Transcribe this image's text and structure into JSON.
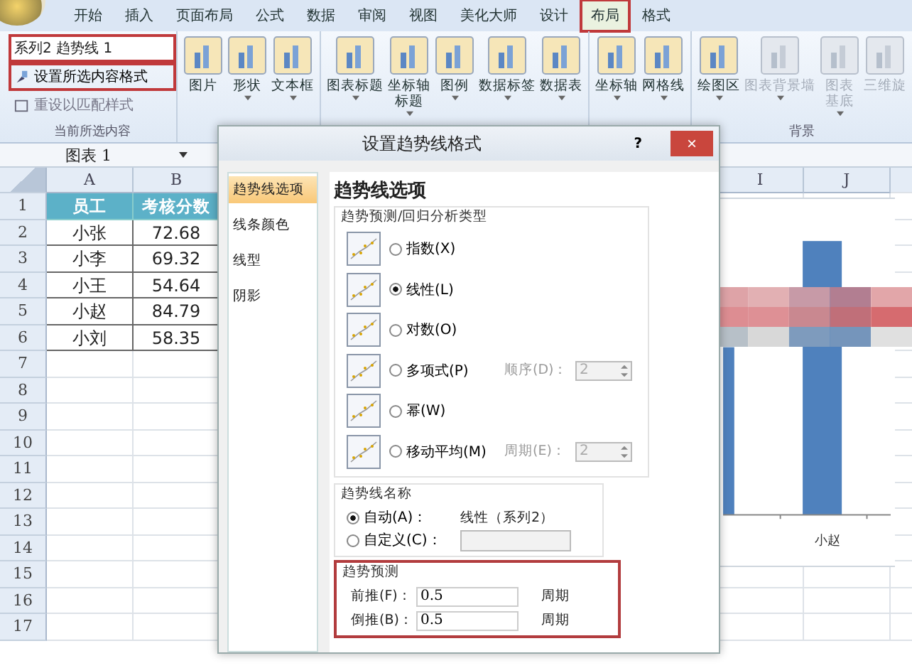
{
  "ribbon_tabs": [
    {
      "label": "开始",
      "selected": false,
      "highlighted": false
    },
    {
      "label": "插入",
      "selected": false,
      "highlighted": false
    },
    {
      "label": "页面布局",
      "selected": false,
      "highlighted": false
    },
    {
      "label": "公式",
      "selected": false,
      "highlighted": false
    },
    {
      "label": "数据",
      "selected": false,
      "highlighted": false
    },
    {
      "label": "审阅",
      "selected": false,
      "highlighted": false
    },
    {
      "label": "视图",
      "selected": false,
      "highlighted": false
    },
    {
      "label": "美化大师",
      "selected": false,
      "highlighted": false
    },
    {
      "label": "设计",
      "selected": false,
      "highlighted": false
    },
    {
      "label": "布局",
      "selected": true,
      "highlighted": true
    },
    {
      "label": "格式",
      "selected": false,
      "highlighted": false
    }
  ],
  "selection_group": {
    "element_dropdown": {
      "value": "系列2 趋势线 1",
      "highlighted": true
    },
    "format_button": {
      "label": "设置所选内容格式",
      "highlighted": true
    },
    "reset_button": {
      "label": "重设以匹配样式"
    },
    "label": "当前所选内容"
  },
  "ribbon_groups": [
    {
      "buttons": [
        {
          "lines": [
            "图片"
          ],
          "dropdown": false,
          "disabled": false
        },
        {
          "lines": [
            "形状"
          ],
          "dropdown": true,
          "disabled": false
        },
        {
          "lines": [
            "文本框"
          ],
          "dropdown": true,
          "disabled": false
        }
      ]
    },
    {
      "buttons": [
        {
          "lines": [
            "图表标题"
          ],
          "dropdown": true,
          "disabled": false
        },
        {
          "lines": [
            "坐标轴",
            "标题"
          ],
          "dropdown": true,
          "disabled": false
        },
        {
          "lines": [
            "图例"
          ],
          "dropdown": true,
          "disabled": false
        },
        {
          "lines": [
            "数据标签"
          ],
          "dropdown": true,
          "disabled": false
        },
        {
          "lines": [
            "数据表"
          ],
          "dropdown": true,
          "disabled": false
        }
      ]
    },
    {
      "buttons": [
        {
          "lines": [
            "坐标轴"
          ],
          "dropdown": true,
          "disabled": false
        },
        {
          "lines": [
            "网格线"
          ],
          "dropdown": true,
          "disabled": false
        }
      ]
    },
    {
      "label": "背景",
      "buttons": [
        {
          "lines": [
            "绘图区"
          ],
          "dropdown": true,
          "disabled": false
        },
        {
          "lines": [
            "图表背景墙"
          ],
          "dropdown": true,
          "disabled": true
        },
        {
          "lines": [
            "图表",
            "基底"
          ],
          "dropdown": true,
          "disabled": true
        },
        {
          "lines": [
            "三维旋"
          ],
          "dropdown": false,
          "disabled": true
        }
      ]
    }
  ],
  "name_box": "图表 1",
  "sheet": {
    "columns_left": [
      "A",
      "B"
    ],
    "columns_right": [
      "I",
      "J"
    ],
    "row_numbers": [
      "1",
      "2",
      "3",
      "4",
      "5",
      "6",
      "7",
      "8",
      "9",
      "10",
      "11",
      "12",
      "13",
      "14",
      "15",
      "16",
      "17"
    ],
    "rows": [
      {
        "name": "员工",
        "score": "考核分数",
        "header": true
      },
      {
        "name": "小张",
        "score": "72.68",
        "header": false
      },
      {
        "name": "小李",
        "score": "69.32",
        "header": false
      },
      {
        "name": "小王",
        "score": "54.64",
        "header": false
      },
      {
        "name": "小赵",
        "score": "84.79",
        "header": false
      },
      {
        "name": "小刘",
        "score": "58.35",
        "header": false
      }
    ]
  },
  "chart": {
    "category_label": "小赵"
  },
  "dialog": {
    "title": "设置趋势线格式",
    "help_button": "?",
    "close_button": "×",
    "nav": [
      {
        "label": "趋势线选项",
        "selected": true
      },
      {
        "label": "线条颜色",
        "selected": false
      },
      {
        "label": "线型",
        "selected": false
      },
      {
        "label": "阴影",
        "selected": false
      }
    ],
    "heading": "趋势线选项",
    "type_group": {
      "label": "趋势预测/回归分析类型",
      "options": [
        {
          "label": "指数(X)",
          "selected": false
        },
        {
          "label": "线性(L)",
          "selected": true
        },
        {
          "label": "对数(O)",
          "selected": false
        },
        {
          "label": "多项式(P)",
          "selected": false,
          "param_label": "顺序(D)：",
          "param_value": "2",
          "param_disabled": true
        },
        {
          "label": "幂(W)",
          "selected": false
        },
        {
          "label": "移动平均(M)",
          "selected": false,
          "param_label": "周期(E)：",
          "param_value": "2",
          "param_disabled": true
        }
      ]
    },
    "name_group": {
      "label": "趋势线名称",
      "auto": {
        "label": "自动(A)：",
        "value": "线性（系列2）",
        "selected": true
      },
      "custom": {
        "label": "自定义(C)：",
        "selected": false
      }
    },
    "forecast_group": {
      "label": "趋势预测",
      "highlighted": true,
      "rows": [
        {
          "label": "前推(F)：",
          "value": "0.5",
          "unit": "周期"
        },
        {
          "label": "倒推(B)：",
          "value": "0.5",
          "unit": "周期"
        }
      ]
    }
  }
}
